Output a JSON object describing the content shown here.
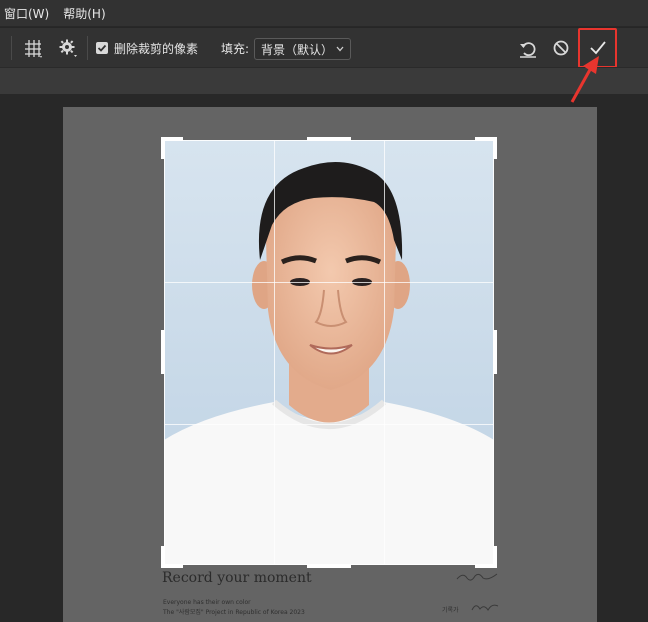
{
  "menu": {
    "items": [
      "窗口(W)",
      "帮助(H)"
    ]
  },
  "options": {
    "delete_cropped_label": "删除裁剪的像素",
    "delete_cropped_checked": true,
    "fill_label": "填充:",
    "fill_value": "背景（默认）"
  },
  "icons": {
    "overlay": "grid-icon",
    "settings": "gear-icon",
    "reset": "reset-icon",
    "cancel": "cancel-icon",
    "commit": "checkmark-icon"
  },
  "colors": {
    "highlight": "#e8352e",
    "ui_bg": "#323232",
    "canvas_bg": "#282828",
    "document_bg": "#646464"
  },
  "document": {
    "headline": "Record your moment",
    "line1": "Everyone has their own color",
    "line2": "The \"사람모집\" Project  in Republic of Korea 2023",
    "credit": "기록가"
  }
}
